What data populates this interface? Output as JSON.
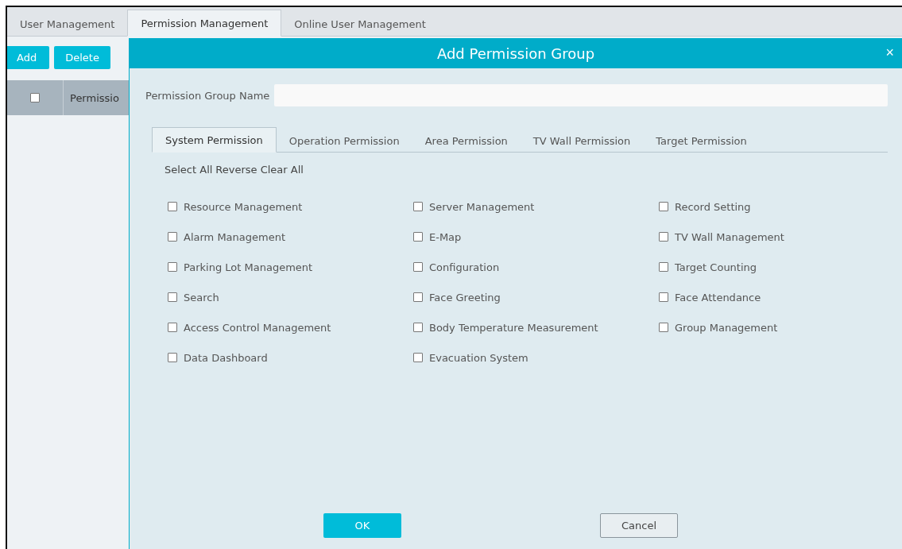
{
  "top_tabs": [
    {
      "label": "User Management",
      "selected": false
    },
    {
      "label": "Permission Management",
      "selected": true
    },
    {
      "label": "Online User Management",
      "selected": false
    }
  ],
  "toolbar": {
    "buttons": [
      "Add",
      "Delete"
    ]
  },
  "table": {
    "header_checked": false,
    "column_1": "Permissio"
  },
  "dialog": {
    "title": "Add Permission Group",
    "close": "×",
    "name_label": "Permission Group Name",
    "tabs": [
      {
        "label": "System Permission",
        "selected": true
      },
      {
        "label": "Operation Permission",
        "selected": false
      },
      {
        "label": "Area Permission",
        "selected": false
      },
      {
        "label": "TV Wall Permission",
        "selected": false
      },
      {
        "label": "Target Permission",
        "selected": false
      }
    ],
    "bulk_actions": [
      "Select All",
      "Reverse",
      "Clear All"
    ],
    "permissions": [
      {
        "label": "Resource Management",
        "checked": false
      },
      {
        "label": "Server Management",
        "checked": false
      },
      {
        "label": "Record Setting",
        "checked": false
      },
      {
        "label": "Alarm Management",
        "checked": false
      },
      {
        "label": "E-Map",
        "checked": false
      },
      {
        "label": "TV Wall Management",
        "checked": false
      },
      {
        "label": "Parking Lot Management",
        "checked": false
      },
      {
        "label": "Configuration",
        "checked": false
      },
      {
        "label": "Target Counting",
        "checked": false
      },
      {
        "label": "Search",
        "checked": false
      },
      {
        "label": "Face Greeting",
        "checked": false
      },
      {
        "label": "Face Attendance",
        "checked": false
      },
      {
        "label": "Access Control Management",
        "checked": false
      },
      {
        "label": "Body Temperature Measurement",
        "checked": false
      },
      {
        "label": "Group Management",
        "checked": false
      },
      {
        "label": "Data Dashboard",
        "checked": false
      },
      {
        "label": "Evacuation System",
        "checked": false
      }
    ],
    "ok": "OK",
    "cancel": "Cancel"
  }
}
